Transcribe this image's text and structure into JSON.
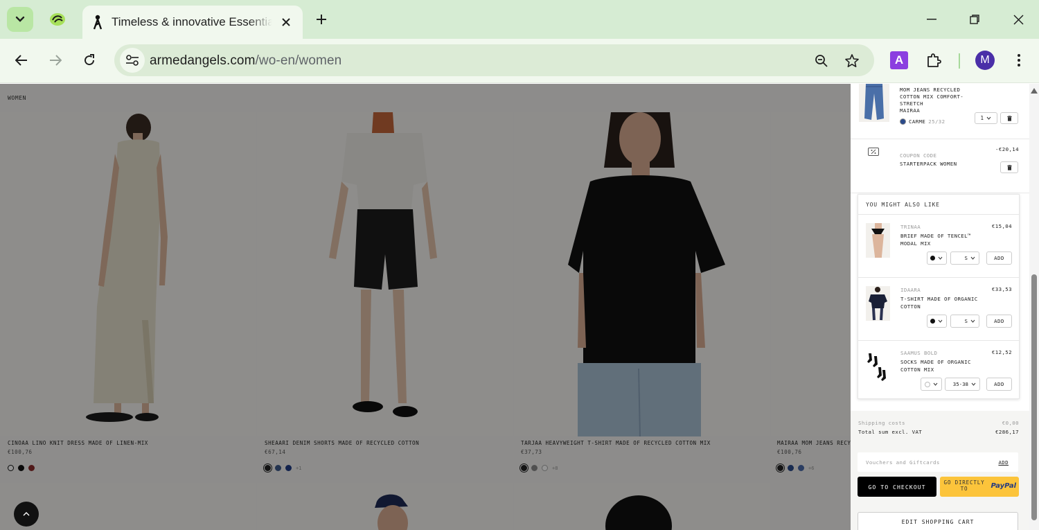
{
  "browser": {
    "tab_title": "Timeless & innovative Essentials",
    "url_domain": "armedangels.com",
    "url_path": "/wo-en/women",
    "avatar_letter": "M",
    "extension_letter": "A"
  },
  "page": {
    "breadcrumb": "WOMEN",
    "products": [
      {
        "name": "CINOAA LINO KNIT DRESS MADE OF LINEN-MIX",
        "price": "€100,76",
        "swatches": [
          "#ffffff",
          "#111111",
          "#8b2b2b"
        ],
        "more": ""
      },
      {
        "name": "SHEAARI DENIM SHORTS MADE OF RECYCLED COTTON",
        "price": "€67,14",
        "swatches": [
          "#222222",
          "#3e5a8a",
          "#1f3b86"
        ],
        "more": "+1"
      },
      {
        "name": "TARJAA HEAVYWEIGHT T-SHIRT MADE OF RECYCLED COTTON MIX",
        "price": "€37,73",
        "swatches": [
          "#222222",
          "#8b8b8b",
          "#ffffff"
        ],
        "more": "+8"
      },
      {
        "name": "MAIRAA MOM JEANS RECYCLED COTTON MIX COMFORT-STRETCH",
        "price": "€100,76",
        "swatches": [
          "#222222",
          "#2a4a8a",
          "#4a6aa8"
        ],
        "more": "+6"
      }
    ]
  },
  "cart": {
    "item": {
      "name": "MOM JEANS RECYCLED COTTON MIX COMFORT-STRETCH",
      "brand": "MAIRAA",
      "color": "CARME",
      "size": "25/32",
      "qty": "1"
    },
    "coupon": {
      "label": "COUPON CODE",
      "name": "STARTERPACK WOMEN",
      "amount": "-€20,14"
    },
    "recommendations_title": "YOU MIGHT ALSO LIKE",
    "recommendations": [
      {
        "brand": "TRINAA",
        "name": "BRIEF MADE OF TENCEL™ MODAL MIX",
        "price": "€15,04",
        "size": "S",
        "add": "ADD"
      },
      {
        "brand": "IDAARA",
        "name": "T-SHIRT MADE OF ORGANIC COTTON",
        "price": "€33,53",
        "size": "S",
        "add": "ADD"
      },
      {
        "brand": "SAAMUS BOLD",
        "name": "SOCKS MADE OF ORGANIC COTTON MIX",
        "price": "€12,52",
        "size": "35-38",
        "add": "ADD"
      }
    ],
    "shipping_label": "Shipping costs",
    "shipping_value": "€0,00",
    "total_label": "Total sum excl. VAT",
    "total_value": "€286,17",
    "voucher_placeholder": "Vouchers and Giftcards",
    "voucher_add": "ADD",
    "checkout_label": "GO TO CHECKOUT",
    "paypal_label": "GO DIRECTLY TO",
    "paypal_brand": "PayPal",
    "edit_cart_label": "EDIT SHOPPING CART"
  },
  "colors": {
    "tabbar_bg": "#d6ecd3",
    "toolbar_bg": "#f1f8ee",
    "paypal_yellow": "#fcc43b",
    "paypal_blue": "#253b80",
    "checkout_black": "#000000"
  }
}
